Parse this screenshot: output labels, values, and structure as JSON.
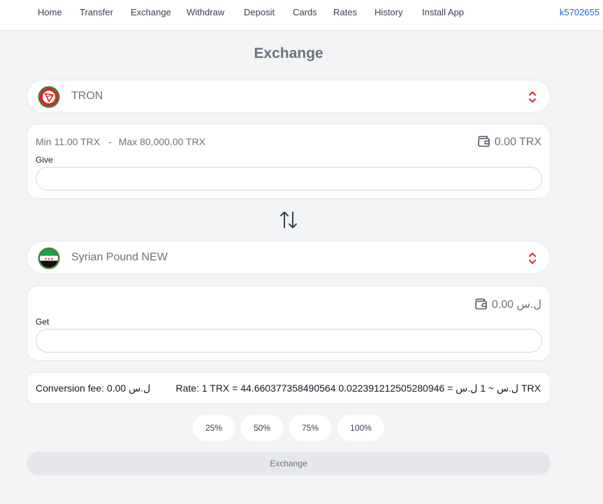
{
  "nav": {
    "items": [
      {
        "label": "Home"
      },
      {
        "label": "Transfer"
      },
      {
        "label": "Exchange"
      },
      {
        "label": "Withdraw"
      },
      {
        "label": "Deposit"
      },
      {
        "label": "Cards"
      },
      {
        "label": "Rates"
      },
      {
        "label": "History"
      },
      {
        "label": "Install App"
      }
    ],
    "user": "k5702655"
  },
  "page": {
    "title": "Exchange"
  },
  "from": {
    "currency": "TRON",
    "icon": "tron-logo-icon",
    "min": "Min 11.00 TRX",
    "dash": "-",
    "max": "Max 80,000.00 TRX",
    "balance": "0.00 TRX",
    "label": "Give",
    "value": ""
  },
  "to": {
    "currency": "Syrian Pound NEW",
    "icon": "syria-flag-icon",
    "balance": "ل.س 0.00",
    "label": "Get",
    "value": ""
  },
  "fee": {
    "text": "Conversion fee: 0.00 ل.س",
    "rate": "Rate: 1 TRX = 44.660377358490564 ل.س ~ 1 ل.س = 0.022391212505280946 TRX"
  },
  "percent_buttons": [
    {
      "label": "25%"
    },
    {
      "label": "50%"
    },
    {
      "label": "75%"
    },
    {
      "label": "100%"
    }
  ],
  "submit": {
    "label": "Exchange"
  },
  "colors": {
    "accent_red": "#dc2626",
    "link_blue": "#2563eb",
    "background": "#f3f4f6"
  }
}
